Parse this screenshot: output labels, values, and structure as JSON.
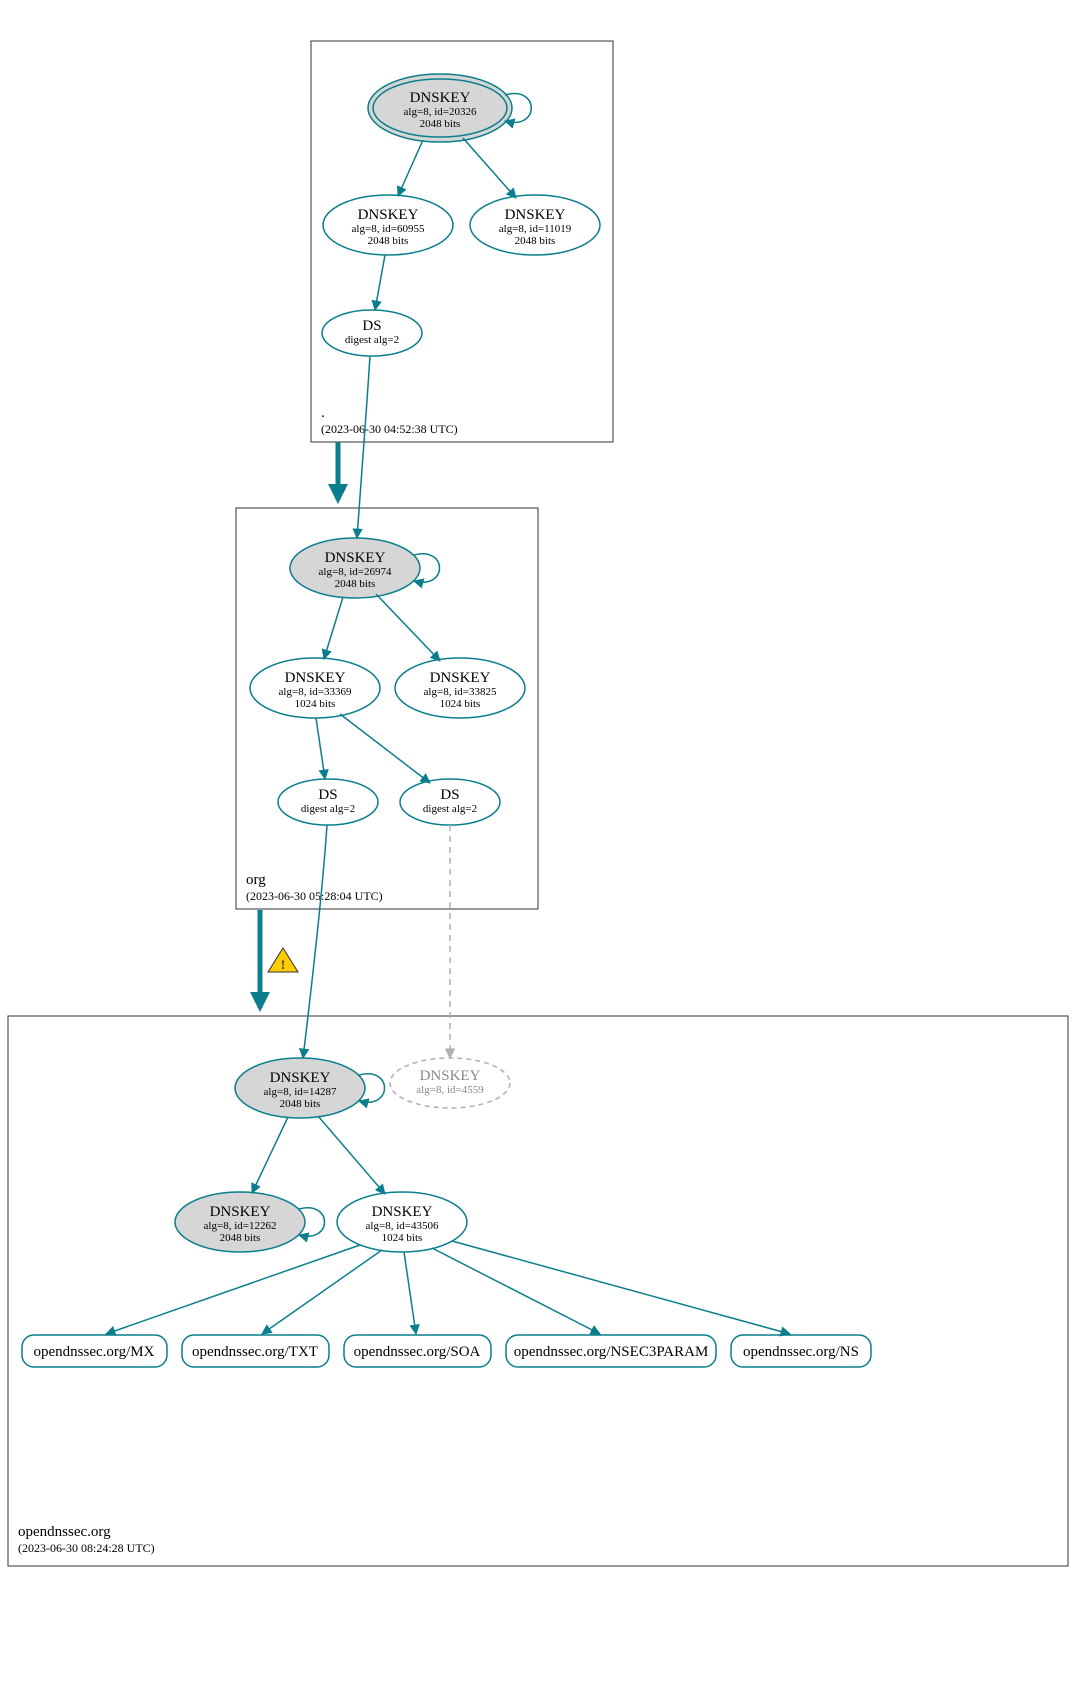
{
  "colors": {
    "teal": "#0a7e8c",
    "grayFill": "#d6d6d6",
    "grayStroke": "#b0b0b0",
    "warn": "#ffcc00",
    "warnStroke": "#333333",
    "box": "#333333"
  },
  "zones": [
    {
      "id": "root",
      "label": ".",
      "time": "(2023-06-30 04:52:38 UTC)"
    },
    {
      "id": "org",
      "label": "org",
      "time": "(2023-06-30 05:28:04 UTC)"
    },
    {
      "id": "opendnssec",
      "label": "opendnssec.org",
      "time": "(2023-06-30 08:24:28 UTC)"
    }
  ],
  "nodes": {
    "root_ksk": {
      "title": "DNSKEY",
      "line1": "alg=8, id=20326",
      "line2": "2048 bits"
    },
    "root_zsk1": {
      "title": "DNSKEY",
      "line1": "alg=8, id=60955",
      "line2": "2048 bits"
    },
    "root_zsk2": {
      "title": "DNSKEY",
      "line1": "alg=8, id=11019",
      "line2": "2048 bits"
    },
    "root_ds": {
      "title": "DS",
      "line1": "digest alg=2",
      "line2": ""
    },
    "org_ksk": {
      "title": "DNSKEY",
      "line1": "alg=8, id=26974",
      "line2": "2048 bits"
    },
    "org_zsk1": {
      "title": "DNSKEY",
      "line1": "alg=8, id=33369",
      "line2": "1024 bits"
    },
    "org_zsk2": {
      "title": "DNSKEY",
      "line1": "alg=8, id=33825",
      "line2": "1024 bits"
    },
    "org_ds1": {
      "title": "DS",
      "line1": "digest alg=2",
      "line2": ""
    },
    "org_ds2": {
      "title": "DS",
      "line1": "digest alg=2",
      "line2": ""
    },
    "od_ksk": {
      "title": "DNSKEY",
      "line1": "alg=8, id=14287",
      "line2": "2048 bits"
    },
    "od_ghost": {
      "title": "DNSKEY",
      "line1": "alg=8, id=4559",
      "line2": ""
    },
    "od_key2": {
      "title": "DNSKEY",
      "line1": "alg=8, id=12262",
      "line2": "2048 bits"
    },
    "od_zsk": {
      "title": "DNSKEY",
      "line1": "alg=8, id=43506",
      "line2": "1024 bits"
    }
  },
  "rrsets": [
    {
      "label": "opendnssec.org/MX"
    },
    {
      "label": "opendnssec.org/TXT"
    },
    {
      "label": "opendnssec.org/SOA"
    },
    {
      "label": "opendnssec.org/NSEC3PARAM"
    },
    {
      "label": "opendnssec.org/NS"
    }
  ]
}
